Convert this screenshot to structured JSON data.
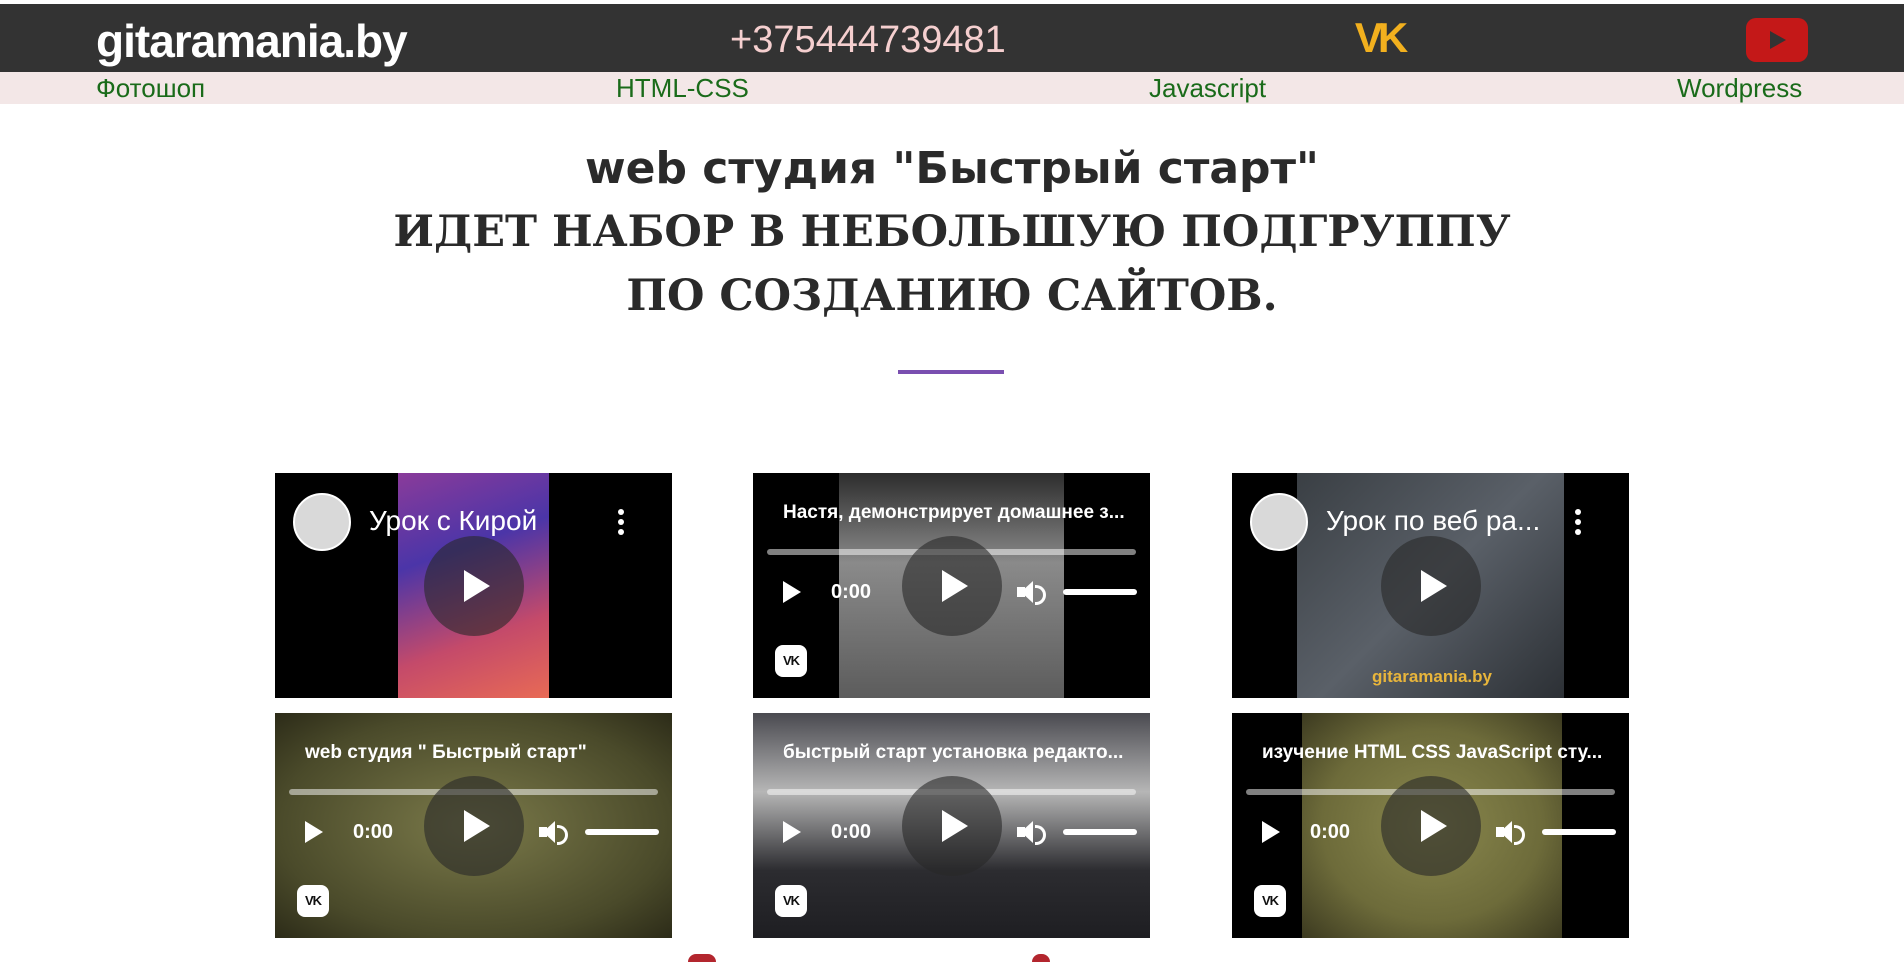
{
  "header": {
    "logo_text": "gitaramania.by",
    "phone": "+375444739481",
    "vk_icon": "vk-logo-icon",
    "youtube_icon": "youtube-play-icon"
  },
  "nav": {
    "items": [
      {
        "label": "Фотошоп"
      },
      {
        "label": "HTML-CSS"
      },
      {
        "label": "Javascript"
      },
      {
        "label": "Wordpress"
      }
    ]
  },
  "hero": {
    "subtitle": "web студия \"Быстрый старт\"",
    "title": "ИДЕТ НАБОР В НЕБОЛЬШУЮ ПОДГРУППУ ПО СОЗДАНИЮ САЙТОВ."
  },
  "videos": [
    {
      "player": "youtube",
      "title": "Урок с Кирой"
    },
    {
      "player": "vk",
      "title": "Настя, демонстрирует домашнее з...",
      "time": "0:00",
      "badge": "VK"
    },
    {
      "player": "youtube",
      "title": "Урок по веб ра...",
      "caption": "gitaramania.by"
    },
    {
      "player": "vk",
      "title": "web студия \" Быстрый старт\"",
      "time": "0:00",
      "badge": "VK"
    },
    {
      "player": "vk",
      "title": "быстрый старт установка редакто...",
      "time": "0:00",
      "badge": "VK"
    },
    {
      "player": "vk",
      "title": "изучение HTML CSS JavaScript сту...",
      "time": "0:00",
      "badge": "VK"
    }
  ],
  "colors": {
    "header_bg": "#333333",
    "nav_bg": "#f3e7e7",
    "nav_link": "#1a6b1a",
    "phone": "#f5cfcf",
    "vk_brand": "#f2b01e",
    "youtube_brand": "#c41818",
    "divider": "#7a4fb0"
  }
}
